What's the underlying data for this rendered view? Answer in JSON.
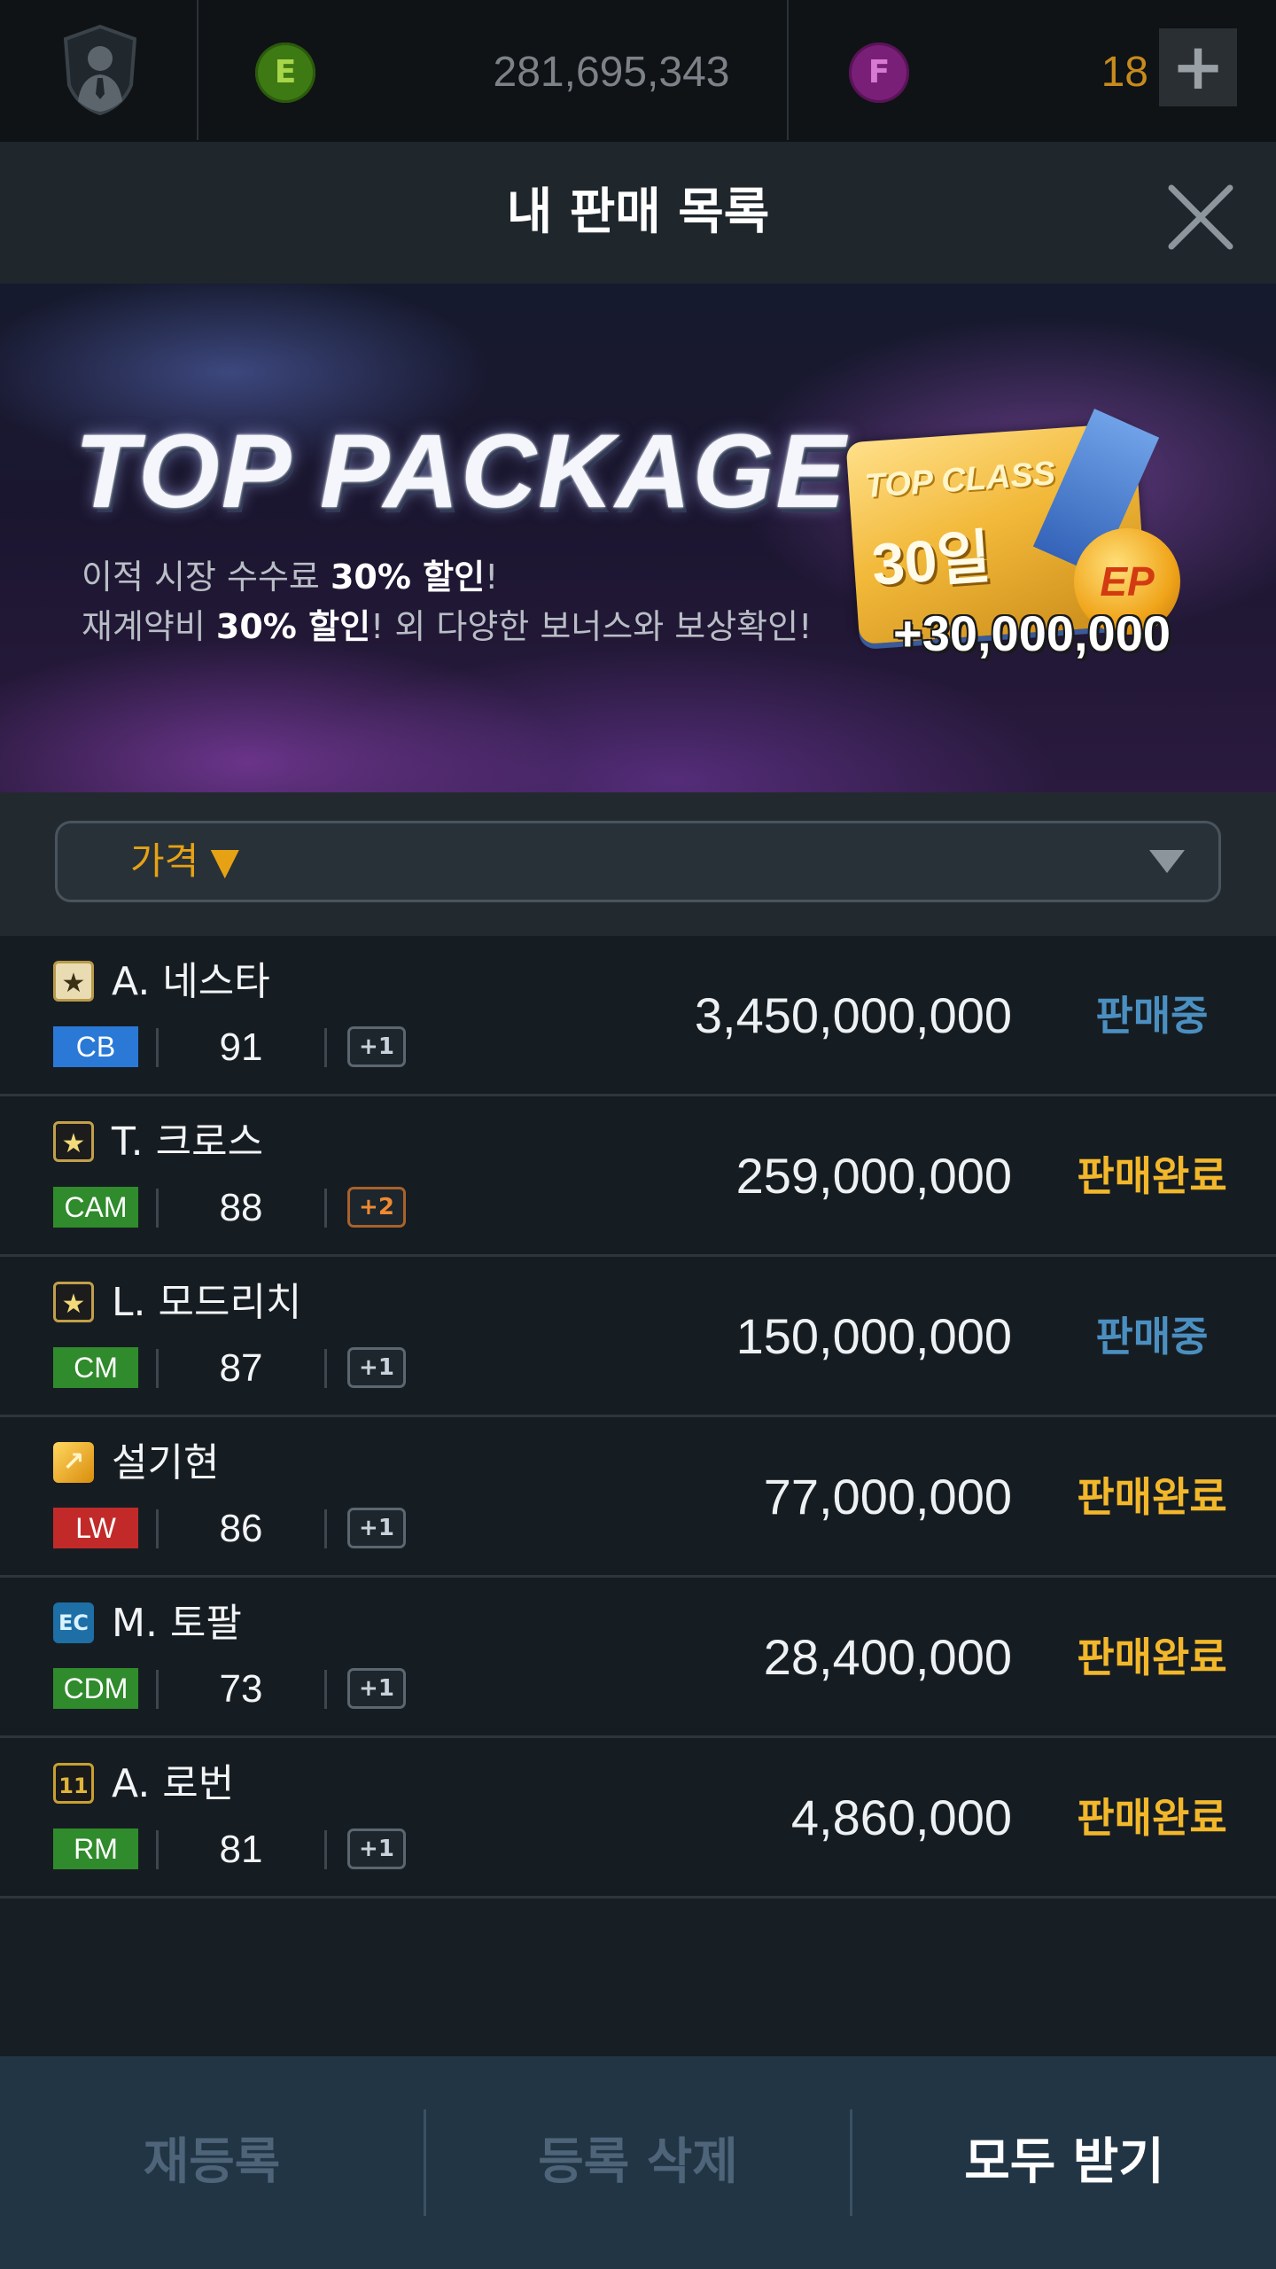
{
  "topbar": {
    "ep_coin_label": "E",
    "ep_amount": "281,695,343",
    "fc_coin_label": "F",
    "fc_amount": "18",
    "add_label": "+"
  },
  "header": {
    "title": "내 판매 목록"
  },
  "banner": {
    "title": "TOP PACKAGE",
    "line1_a": "이적 시장 수수료 ",
    "line1_b": "30% 할인",
    "line1_c": "!",
    "line2_a": "재계약비 ",
    "line2_b": "30% 할인",
    "line2_c": "! 외 다양한 보너스와 보상확인!",
    "card_title": "TOP CLASS",
    "card_days": "30일",
    "card_coin": "EP",
    "card_bonus": "+30,000,000"
  },
  "filter": {
    "label": "가격 ▼"
  },
  "listings": [
    {
      "grade": "★",
      "name": "A. 네스타",
      "position": "CB",
      "ovr": "91",
      "enhance": "+1",
      "price": "3,450,000,000",
      "status": "판매중"
    },
    {
      "grade": "★",
      "name": "T. 크로스",
      "position": "CAM",
      "ovr": "88",
      "enhance": "+2",
      "price": "259,000,000",
      "status": "판매완료"
    },
    {
      "grade": "★",
      "name": "L. 모드리치",
      "position": "CM",
      "ovr": "87",
      "enhance": "+1",
      "price": "150,000,000",
      "status": "판매중"
    },
    {
      "grade": "↗",
      "name": "설기현",
      "position": "LW",
      "ovr": "86",
      "enhance": "+1",
      "price": "77,000,000",
      "status": "판매완료"
    },
    {
      "grade": "EC",
      "name": "M. 토팔",
      "position": "CDM",
      "ovr": "73",
      "enhance": "+1",
      "price": "28,400,000",
      "status": "판매완료"
    },
    {
      "grade": "11",
      "name": "A. 로번",
      "position": "RM",
      "ovr": "81",
      "enhance": "+1",
      "price": "4,860,000",
      "status": "판매완료"
    }
  ],
  "footer": {
    "relist_label": "재등록",
    "delete_label": "등록 삭제",
    "receive_all_label": "모두 받기"
  },
  "colors": {
    "status_on_sale": "#4b8fc1",
    "status_sold": "#f2b72b",
    "pos_defender": "#2a79d6",
    "pos_midfielder": "#2f8b2b",
    "pos_forward": "#c22a2a"
  },
  "icons": {
    "avatar": "manager-silhouette-icon",
    "close": "close-x-icon",
    "filter_toggle": "triangle-down-icon"
  }
}
